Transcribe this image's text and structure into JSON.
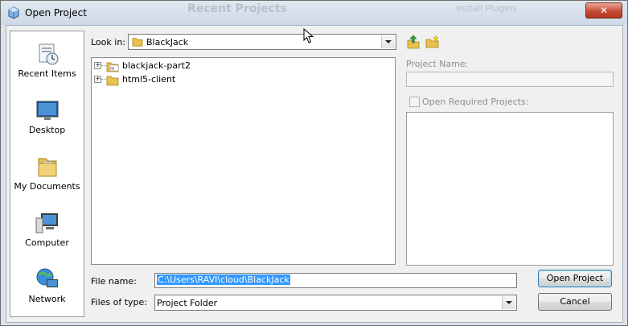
{
  "window": {
    "title": "Open Project"
  },
  "background": {
    "ghost_title": "Recent Projects",
    "ghost_link": "Install Plugins"
  },
  "places": [
    {
      "label": "Recent Items",
      "icon": "recent-items-icon"
    },
    {
      "label": "Desktop",
      "icon": "desktop-icon"
    },
    {
      "label": "My Documents",
      "icon": "my-documents-icon"
    },
    {
      "label": "Computer",
      "icon": "computer-icon"
    },
    {
      "label": "Network",
      "icon": "network-icon"
    }
  ],
  "look_in": {
    "label": "Look in:",
    "value": "BlackJack"
  },
  "toolbar": {
    "up_icon": "up-one-level-icon",
    "new_folder_icon": "new-folder-icon"
  },
  "tree": [
    {
      "name": "blackjack-part2",
      "icon": "maven-project-icon"
    },
    {
      "name": "html5-client",
      "icon": "folder-icon"
    }
  ],
  "right_panel": {
    "project_name_label": "Project Name:",
    "project_name_value": "",
    "open_required_label": "Open Required Projects:",
    "open_required_checked": false
  },
  "file_name": {
    "label": "File name:",
    "value": "C:\\Users\\RAVI\\cloud\\BlackJack"
  },
  "files_of_type": {
    "label": "Files of type:",
    "value": "Project Folder"
  },
  "buttons": {
    "open": "Open Project",
    "cancel": "Cancel"
  },
  "colors": {
    "selection": "#3399ff",
    "close_button": "#c4472f",
    "folder": "#e8c150"
  }
}
